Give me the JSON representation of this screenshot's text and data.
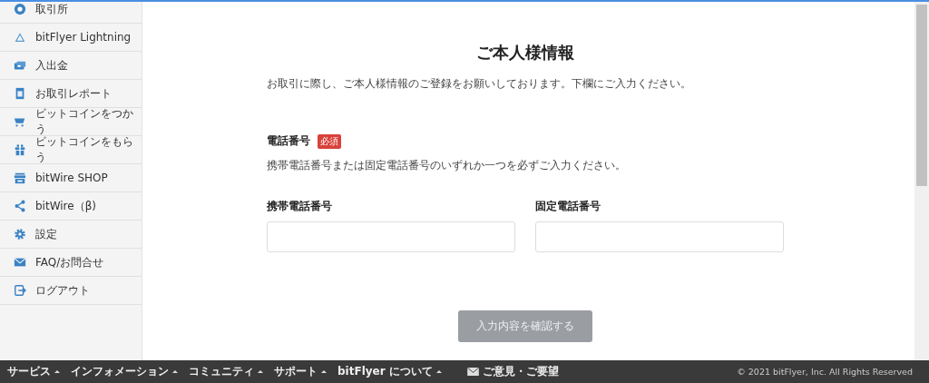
{
  "sidebar": {
    "items": [
      {
        "label": "取引所"
      },
      {
        "label": "bitFlyer Lightning"
      },
      {
        "label": "入出金"
      },
      {
        "label": "お取引レポート"
      },
      {
        "label": "ビットコインをつかう"
      },
      {
        "label": "ビットコインをもらう"
      },
      {
        "label": "bitWire SHOP"
      },
      {
        "label": "bitWire（β)"
      },
      {
        "label": "設定"
      },
      {
        "label": "FAQ/お問合せ"
      },
      {
        "label": "ログアウト"
      }
    ]
  },
  "page": {
    "title": "ご本人様情報",
    "intro": "お取引に際し、ご本人様情報のご登録をお願いしております。下欄にご入力ください。",
    "section": {
      "heading": "電話番号",
      "badge": "必須",
      "note": "携帯電話番号または固定電話番号のいずれか一つを必ずご入力ください。"
    },
    "fields": [
      {
        "label": "携帯電話番号"
      },
      {
        "label": "固定電話番号"
      }
    ],
    "submit": {
      "label": "入力内容を確認する",
      "disabled": true
    }
  },
  "footer": {
    "menus": [
      "サービス",
      "インフォメーション",
      "コミュニティ",
      "サポート",
      "bitFlyer について"
    ],
    "feedback": "ご意見・ご要望",
    "copyright": "© 2021 bitFlyer, Inc. All Rights Reserved"
  }
}
